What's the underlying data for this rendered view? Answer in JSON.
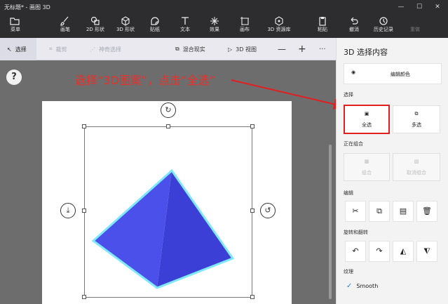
{
  "window": {
    "title": "无标题* - 画图 3D",
    "minimize": "—",
    "maximize": "☐",
    "close": "✕"
  },
  "ribbon": {
    "menu": "菜单",
    "items": [
      "画笔",
      "2D 形状",
      "3D 形状",
      "贴纸",
      "文本",
      "效果",
      "画布",
      "3D 资源库"
    ],
    "right_items": [
      "粘贴",
      "撤消",
      "历史记录",
      "重做"
    ]
  },
  "cmdbar": {
    "select": "选择",
    "crop": "裁剪",
    "magic_select": "神奇选择",
    "mixed_reality": "混合现实",
    "view3d": "3D 视图",
    "zoom_out": "—",
    "zoom_in": "+",
    "more": "···"
  },
  "canvas": {
    "help": "?",
    "annotation": "选择“3D图案”，点击“全选”"
  },
  "panel": {
    "title": "3D 选择内容",
    "edit_color": "编辑颜色",
    "section_select": "选择",
    "select_all": "全选",
    "multi_select": "多选",
    "section_group": "正在组合",
    "group": "组合",
    "ungroup": "取消组合",
    "section_edit": "编辑",
    "section_rotate": "旋转和翻转",
    "section_texture": "纹理",
    "smooth": "Smooth"
  },
  "colors": {
    "pyramid_face_left": "#4a4de8",
    "pyramid_face_right": "#3b3fd6",
    "pyramid_outline": "#7fe8ff",
    "annotation_red": "#e8312a",
    "highlight_red": "#e02020"
  }
}
